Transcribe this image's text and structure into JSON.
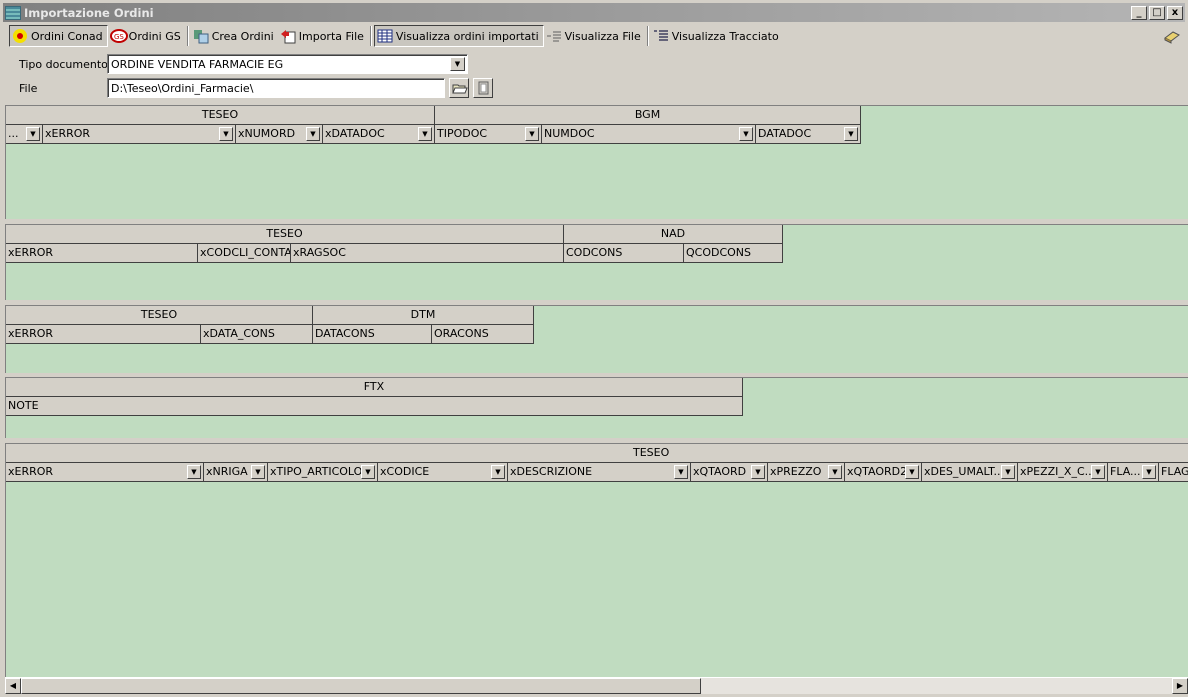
{
  "window": {
    "title": "Importazione Ordini",
    "controls": [
      "_",
      "□",
      "x"
    ]
  },
  "toolbar": {
    "ordini_conad": "Ordini Conad",
    "ordini_gs": "Ordini GS",
    "crea_ordini": "Crea Ordini",
    "importa_file": "Importa File",
    "visualizza_ordini": "Visualizza ordini importati",
    "visualizza_file": "Visualizza File",
    "visualizza_tracciato": "Visualizza Tracciato"
  },
  "form": {
    "tipo_label": "Tipo documento",
    "tipo_value": "ORDINE VENDITA FARMACIE EG",
    "file_label": "File",
    "file_value": "D:\\Teseo\\Ordini_Farmacie\\"
  },
  "grid1": {
    "groups": [
      "TESEO",
      "BGM"
    ],
    "columns": [
      "...",
      "xERROR",
      "xNUMORD",
      "xDATADOC",
      "TIPODOC",
      "NUMDOC",
      "DATADOC"
    ]
  },
  "grid2": {
    "groups": [
      "TESEO",
      "NAD"
    ],
    "columns": [
      "xERROR",
      "xCODCLI_CONTA",
      "xRAGSOC",
      "CODCONS",
      "QCODCONS"
    ]
  },
  "grid3": {
    "groups": [
      "TESEO",
      "DTM"
    ],
    "columns": [
      "xERROR",
      "xDATA_CONS",
      "DATACONS",
      "ORACONS"
    ]
  },
  "grid4": {
    "groups": [
      "FTX"
    ],
    "columns": [
      "NOTE"
    ]
  },
  "grid5": {
    "groups": [
      "TESEO"
    ],
    "columns": [
      "xERROR",
      "xNRIGA",
      "xTIPO_ARTICOLO",
      "xCODICE",
      "xDESCRIZIONE",
      "xQTAORD",
      "xPREZZO",
      "xQTAORD2",
      "xDES_UMALT...",
      "xPEZZI_X_C...",
      "FLA...",
      "FLAG"
    ]
  }
}
